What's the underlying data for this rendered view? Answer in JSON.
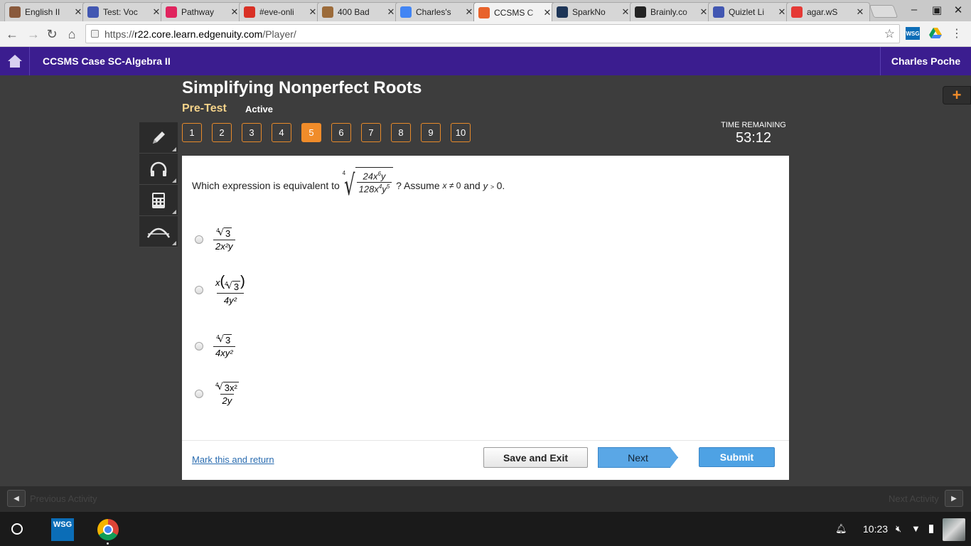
{
  "browser": {
    "tabs": [
      {
        "label": "English II",
        "icon": "person-icon",
        "color": "#8a5a3c"
      },
      {
        "label": "Test: Voc",
        "icon": "quizlet-icon",
        "color": "#4257b2"
      },
      {
        "label": "Pathway",
        "icon": "pathway-icon",
        "color": "#e0245e"
      },
      {
        "label": "#eve-onli",
        "icon": "gmail-icon",
        "color": "#d93025"
      },
      {
        "label": "400 Bad",
        "icon": "bread-icon",
        "color": "#9c6b3a"
      },
      {
        "label": "Charles's",
        "icon": "docs-icon",
        "color": "#4285f4"
      },
      {
        "label": "CCSMS C",
        "icon": "edgenuity-icon",
        "color": "#e8632b"
      },
      {
        "label": "SparkNo",
        "icon": "sparknotes-icon",
        "color": "#1d3557"
      },
      {
        "label": "Brainly.co",
        "icon": "brainly-icon",
        "color": "#222222"
      },
      {
        "label": "Quizlet Li",
        "icon": "quizlet-icon",
        "color": "#4257b2"
      },
      {
        "label": "agar.wS",
        "icon": "agar-icon",
        "color": "#e53935"
      }
    ],
    "active_tab": 6,
    "url_scheme": "https://",
    "url_host": "r22.core.learn.edgenuity.com",
    "url_path": "/Player/",
    "ext_wsg": "WSG"
  },
  "app": {
    "course": "CCSMS Case SC-Algebra II",
    "user": "Charles Poche",
    "accent": "#3b1d8f"
  },
  "lesson": {
    "title": "Simplifying Nonperfect Roots",
    "activity": "Pre-Test",
    "status": "Active",
    "questions": [
      "1",
      "2",
      "3",
      "4",
      "5",
      "6",
      "7",
      "8",
      "9",
      "10"
    ],
    "current": 5,
    "time_label": "TIME REMAINING",
    "time_value": "53:12"
  },
  "question": {
    "prefix": "Which expression is equivalent to",
    "root_index": "4",
    "num_coef": "24",
    "num_x_exp": "6",
    "den_coef": "128",
    "den_x_exp": "4",
    "den_y_exp": "5",
    "assume": "? Assume",
    "cond1_var": "x",
    "cond1_rel": "≠",
    "cond1_val": "0",
    "and": "and",
    "cond2_var": "y",
    "cond2_rel": ">",
    "cond2_val": "0."
  },
  "options": [
    {
      "num_index": "4",
      "num_radicand": "3",
      "den": "2x²y"
    },
    {
      "num_pre": "x",
      "num_index": "4",
      "num_radicand": "3",
      "den": "4y²"
    },
    {
      "num_index": "4",
      "num_radicand": "3",
      "den": "4xy²"
    },
    {
      "num_index": "4",
      "num_radicand": "3x²",
      "den": "2y"
    }
  ],
  "footer": {
    "mark": "Mark this and return",
    "save": "Save and Exit",
    "next": "Next",
    "submit": "Submit"
  },
  "activity_bar": {
    "prev": "Previous Activity",
    "next": "Next Activity"
  },
  "shelf": {
    "wsg": "WSG",
    "time": "10:23"
  }
}
